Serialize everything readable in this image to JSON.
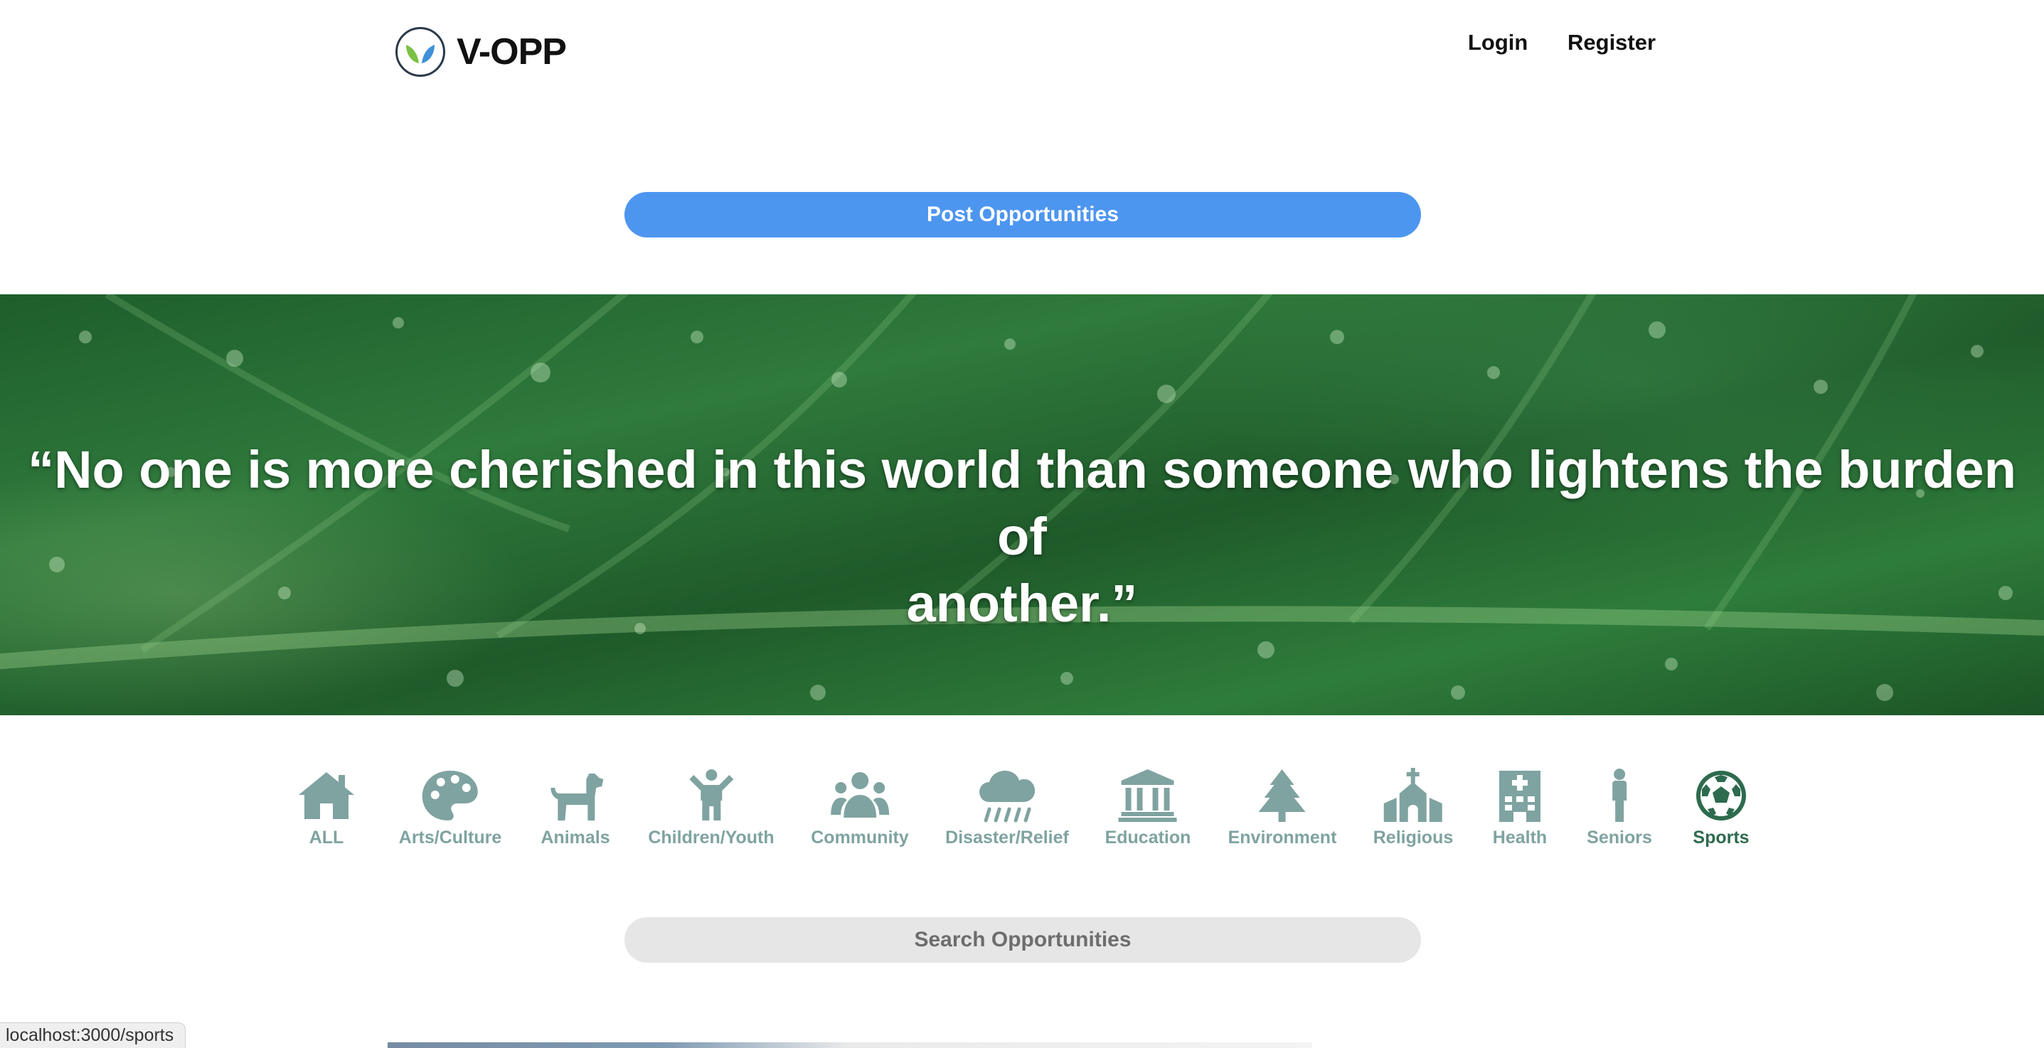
{
  "header": {
    "brand": "V-OPP",
    "nav": {
      "login": "Login",
      "register": "Register"
    }
  },
  "post_button": {
    "label": "Post Opportunities"
  },
  "hero": {
    "quote_line1": "“No one is more cherished in this world than someone who lightens the burden of",
    "quote_line2": "another.”"
  },
  "categories": [
    {
      "label": "ALL",
      "icon": "home-icon",
      "active": false
    },
    {
      "label": "Arts/Culture",
      "icon": "palette-icon",
      "active": false
    },
    {
      "label": "Animals",
      "icon": "dog-icon",
      "active": false
    },
    {
      "label": "Children/Youth",
      "icon": "child-icon",
      "active": false
    },
    {
      "label": "Community",
      "icon": "users-icon",
      "active": false
    },
    {
      "label": "Disaster/Relief",
      "icon": "cloud-rain-icon",
      "active": false
    },
    {
      "label": "Education",
      "icon": "landmark-icon",
      "active": false
    },
    {
      "label": "Environment",
      "icon": "tree-icon",
      "active": false
    },
    {
      "label": "Religious",
      "icon": "church-icon",
      "active": false
    },
    {
      "label": "Health",
      "icon": "hospital-icon",
      "active": false
    },
    {
      "label": "Seniors",
      "icon": "person-icon",
      "active": false
    },
    {
      "label": "Sports",
      "icon": "soccer-ball-icon",
      "active": true
    }
  ],
  "colors": {
    "icon": "#7fa3a0",
    "active": "#2e6b4e",
    "button": "#4d96f0"
  },
  "search": {
    "placeholder": "Search Opportunities"
  },
  "status_bar": {
    "url": "localhost:3000/sports"
  }
}
